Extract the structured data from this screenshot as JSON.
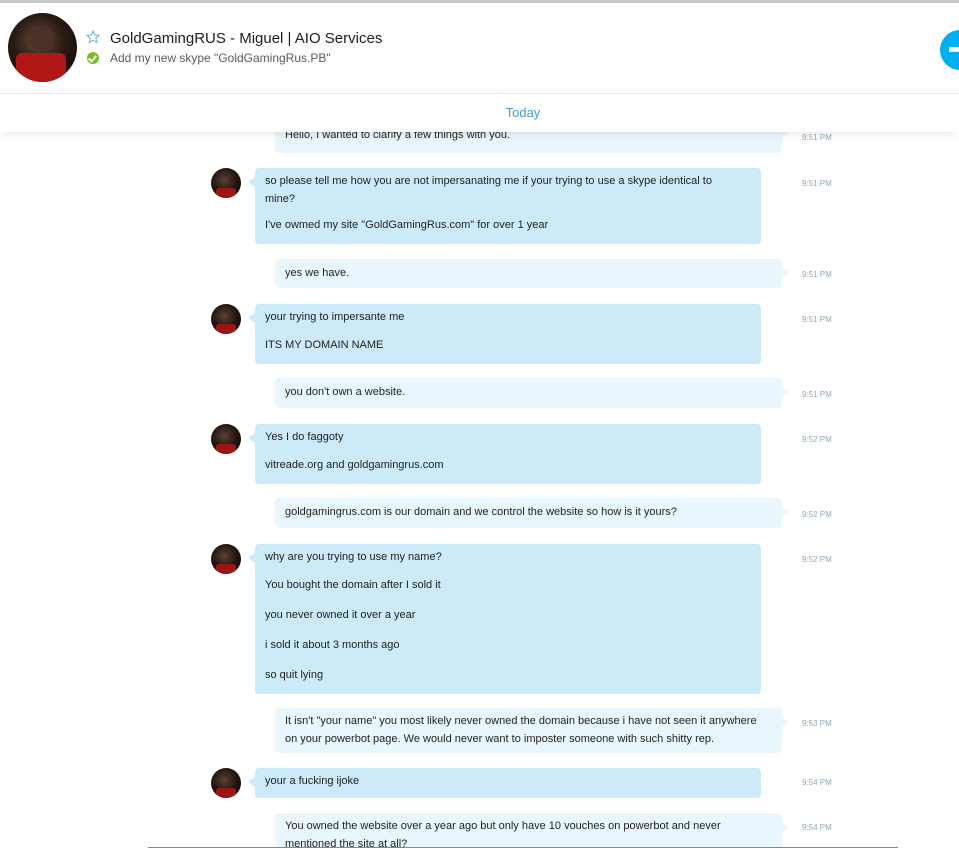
{
  "header": {
    "contact_name": "GoldGamingRUS - Miguel | AIO Services",
    "mood_message": "Add my new skype \"GoldGamingRus.PB\"",
    "star_icon": "star-outline-icon",
    "status_icon": "online-check-icon",
    "call_icon": "call-icon"
  },
  "day_separator": "Today",
  "colors": {
    "accent": "#00aff0",
    "incoming_bubble": "#cdeaf8",
    "outgoing_bubble": "#eaf6fd",
    "timestamp": "#8fa9b5",
    "online": "#7bbb2a"
  },
  "messages": [
    {
      "from": "me",
      "time": "9:51 PM",
      "lines": [
        "Hello, I wanted to clarify a few things with you."
      ]
    },
    {
      "from": "them",
      "time": "9:51 PM",
      "lines": [
        "so please tell me how you are not impersanating me if your trying to use a skype identical to",
        "mine?",
        "I've owmed my site \"GoldGamingRus.com\" for over 1 year"
      ]
    },
    {
      "from": "me",
      "time": "9:51 PM",
      "lines": [
        "yes we have."
      ]
    },
    {
      "from": "them",
      "time": "9:51 PM",
      "lines": [
        "your trying to impersante me",
        "ITS MY DOMAIN NAME"
      ]
    },
    {
      "from": "me",
      "time": "9:51 PM",
      "lines": [
        "you don't own a website."
      ]
    },
    {
      "from": "them",
      "time": "9:52 PM",
      "lines": [
        "Yes I do faggoty",
        "vitreade.org and goldgamingrus.com"
      ]
    },
    {
      "from": "me",
      "time": "9:52 PM",
      "lines": [
        "goldgamingrus.com is our domain and we control the website so how is it yours?"
      ]
    },
    {
      "from": "them",
      "time": "9:52 PM",
      "lines": [
        "why are you trying to use my name?",
        "You bought the domain after I sold it",
        "you never owned it over a year",
        "i sold it about 3 months ago",
        "so quit lying"
      ]
    },
    {
      "from": "me",
      "time": "9:53 PM",
      "lines": [
        "It isn't \"your name\" you most likely never owned the domain because i have not seen it anywhere",
        "on your powerbot page. We would never want to imposter someone with such shitty rep."
      ]
    },
    {
      "from": "them",
      "time": "9:54 PM",
      "lines": [
        "your a fucking ijoke"
      ]
    },
    {
      "from": "me",
      "time": "9:54 PM",
      "lines": [
        "You owned the website over a year ago but only have 10 vouches on powerbot and never",
        "mentioned the site at all?"
      ]
    }
  ]
}
